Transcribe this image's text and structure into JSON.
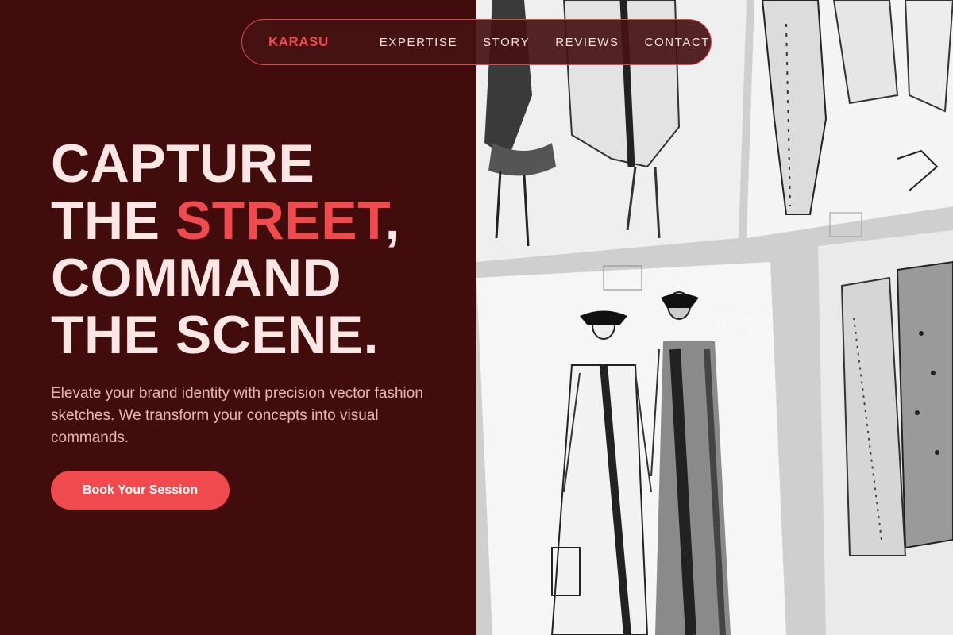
{
  "nav": {
    "brand": "KARASU",
    "links": [
      "EXPERTISE",
      "STORY",
      "REVIEWS",
      "CONTACT"
    ]
  },
  "hero": {
    "line1": "CAPTURE",
    "line2_pre": "THE ",
    "line2_accent": "STREET",
    "line2_post": ",",
    "line3": "COMMAND",
    "line4": "THE SCENE.",
    "subtitle": "Elevate your brand identity with precision vector fashion sketches. We transform your concepts into visual commands.",
    "cta_label": "Book Your Session"
  },
  "image": {
    "watermark": "tokyo"
  },
  "colors": {
    "background": "#430c0c",
    "accent": "#ef4a4e",
    "headline": "#fde6e6",
    "subtitle": "#e6b7b4"
  }
}
